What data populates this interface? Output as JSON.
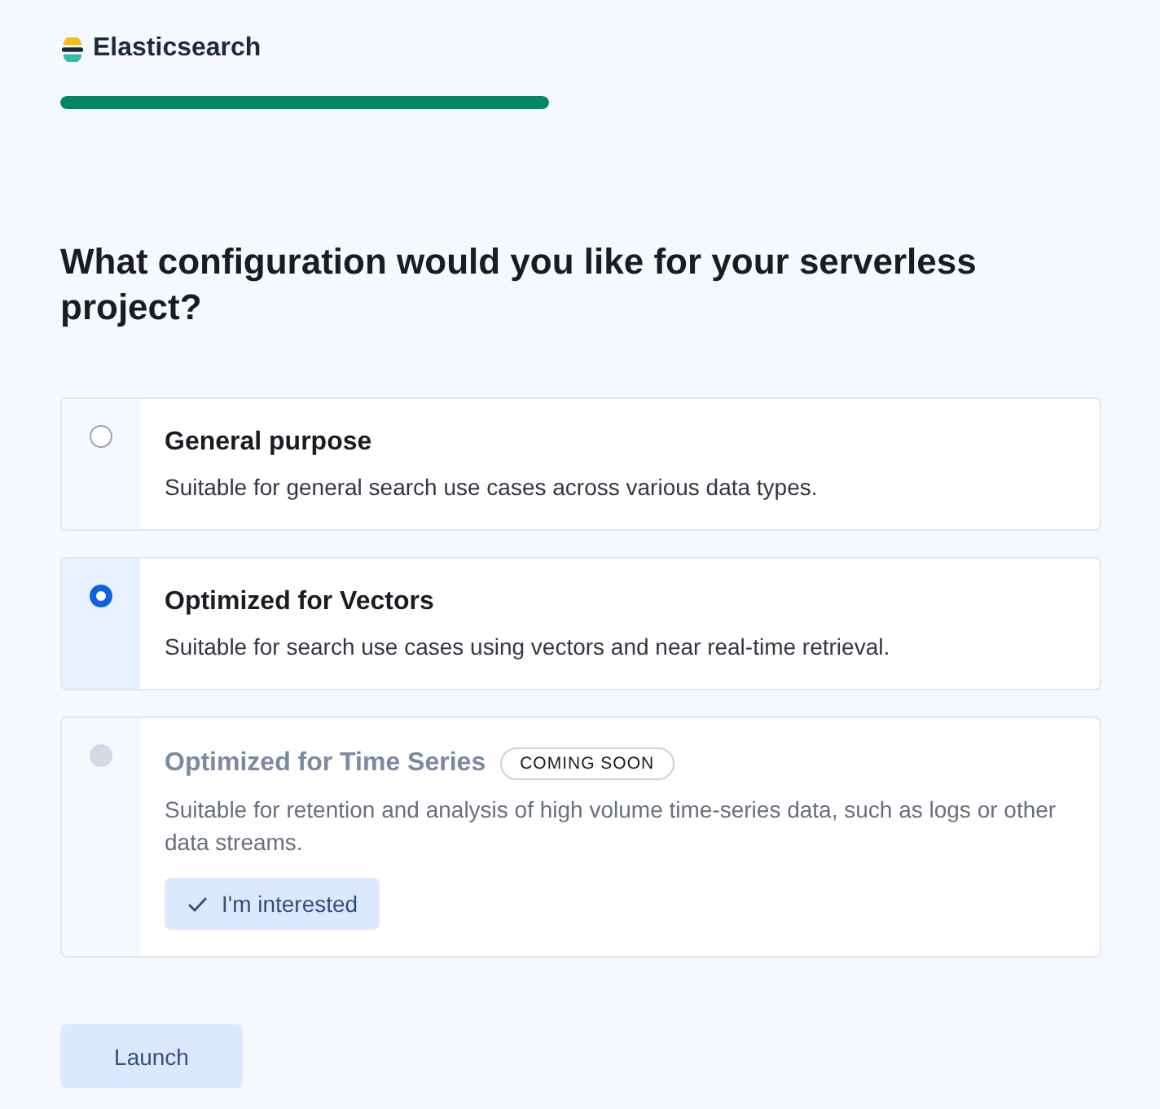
{
  "brand": {
    "name": "Elasticsearch"
  },
  "progress": {
    "level": 1
  },
  "heading": "What configuration would you like for your serverless project?",
  "options": [
    {
      "title": "General purpose",
      "description": "Suitable for general search use cases across various data types.",
      "selected": false,
      "disabled": false
    },
    {
      "title": "Optimized for Vectors",
      "description": "Suitable for search use cases using vectors and near real-time retrieval.",
      "selected": true,
      "disabled": false
    },
    {
      "title": "Optimized for Time Series",
      "badge": "COMING SOON",
      "description": "Suitable for retention and analysis of high volume time-series data, such as logs or other data streams.",
      "selected": false,
      "disabled": true,
      "action": "I'm interested"
    }
  ],
  "launch_button": "Launch"
}
